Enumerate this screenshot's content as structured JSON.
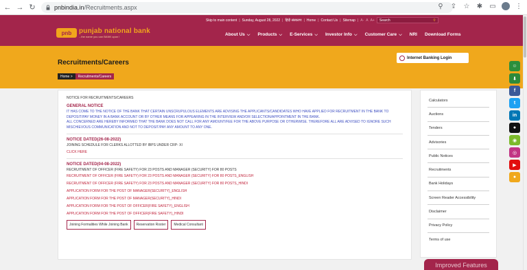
{
  "browser": {
    "url_host": "pnbindia.in",
    "url_path": "/Recruitments.aspx"
  },
  "utility_bar": {
    "skip_link": "Skip to main content",
    "date": "Sunday, August 28, 2022",
    "hindi": "हिंदी संस्करण",
    "home": "Home",
    "contact": "Contact Us",
    "sitemap": "Sitemap",
    "font_small": "A-",
    "font_normal": "A",
    "font_large": "A+",
    "search_placeholder": "Search"
  },
  "logo": {
    "mark": "pnb",
    "brand": "punjab national bank",
    "tagline": "...the name you can BANK upon !"
  },
  "nav": {
    "items": [
      {
        "label": "About Us"
      },
      {
        "label": "Products"
      },
      {
        "label": "E-Services"
      },
      {
        "label": "Investor Info"
      },
      {
        "label": "Customer Care"
      },
      {
        "label": "NRI"
      },
      {
        "label": "Download Forms"
      }
    ]
  },
  "banner": {
    "title": "Recruitments/Careers",
    "breadcrumb_home": "Home >",
    "breadcrumb_current": "Recruitments/Careers",
    "login_label": "Internet Banking Login"
  },
  "main": {
    "header": "NOTICE FOR RECRUITMENTS/CAREERS",
    "general": {
      "title": "GENERAL NOTICE",
      "p1": "IT HAS COME TO THE NOTICE OF THE BANK THAT CERTAIN UNSCRUPULOUS ELEMENTS ARE ADVISING THE APPLICANTS/CANDIDATES WHO HAVE APPLIED FOR RECRUITMENT IN THE BANK TO DEPOSIT/PAY MONEY IN A BANK ACCOUNT OR BY OTHER MEANS FOR APPEARING IN THE INTERVIEW AND/OR SELECTION/APPOINTMENT IN THE BANK.",
      "p2": "ALL CONCERNED ARE HEREBY INFORMED THAT THE BANK DOES NOT CALL FOR ANY AMOUNT/FEE FOR THE ABOVE PURPOSE OR OTHERWISE. THEREFORE ALL ARE ADVISED TO IGNORE SUCH MISCHIEVOUS COMMUNICATION AND NOT TO DEPOSIT/PAY ANY AMOUNT TO ANY ONE."
    },
    "notice1": {
      "title": "NOTICE DATED(26-08-2022)",
      "text": "JOINING SCHEDULE FOR CLERKS ALLOTTED BY IBPS UNDER CRP- XI",
      "link": "CLICK HERE"
    },
    "notice2": {
      "title": "NOTICE DATED(04-08-2022)",
      "rows": [
        {
          "text": "RECRUITMENT OF OFFICER (FIRE SAFETY) FOR 23 POSTS AND MANAGER (SECURITY) FOR 80 POSTS"
        },
        {
          "text": "RECRUITMENT OF OFFICER (FIRE SAFETY) FOR 23 POSTS AND MANAGER (SECURITY) FOR 80 POSTS_ENGLISH"
        },
        {
          "text": "RECRUITMENT OF OFFICER (FIRE SAFETY) FOR 23 POSTS AND MANAGER (SECURITY) FOR 80 POSTS_HINDI"
        },
        {
          "text": "APPLICATION FORM FOR THE POST OF MANAGER(SECURITY)_ENGLISH"
        },
        {
          "text": "APPLICATION FORM FOR THE POST OF MANAGER(SECURITY)_HINDI"
        },
        {
          "text": "APPLICATION FORM FOR THE POST OF OFFICER(FIRE SAFETY)_ENGLISH"
        },
        {
          "text": "APPLICATION FORM FOR THE POST OF OFFICER(FIRE SAFETY)_HINDI"
        }
      ]
    },
    "buttons": [
      {
        "label": "Joining Formalities While Joining Bank"
      },
      {
        "label": "Reservation Roster"
      },
      {
        "label": "Medical Consultant"
      }
    ]
  },
  "sidebar": {
    "items": [
      {
        "label": "Calculators"
      },
      {
        "label": "Auctions"
      },
      {
        "label": "Tenders"
      },
      {
        "label": "Advisories"
      },
      {
        "label": "Public Notices"
      },
      {
        "label": "Recruitments"
      },
      {
        "label": "Bank Holidays"
      },
      {
        "label": "Screen Reader Accessibility"
      },
      {
        "label": "Disclaimer"
      },
      {
        "label": "Privacy Policy"
      },
      {
        "label": "Terms of use"
      }
    ]
  },
  "improved_features": "Improved Features",
  "social_icons": [
    "people-icon",
    "download-icon",
    "facebook-icon",
    "twitter-icon",
    "linkedin-icon",
    "apple-icon",
    "android-icon",
    "instagram-icon",
    "youtube-icon",
    "assistant-icon"
  ],
  "colors": {
    "brand_maroon": "#a3254b",
    "brand_orange": "#f0a81c",
    "link_red": "#c0223a",
    "notice_blue": "#3b4cc0"
  }
}
